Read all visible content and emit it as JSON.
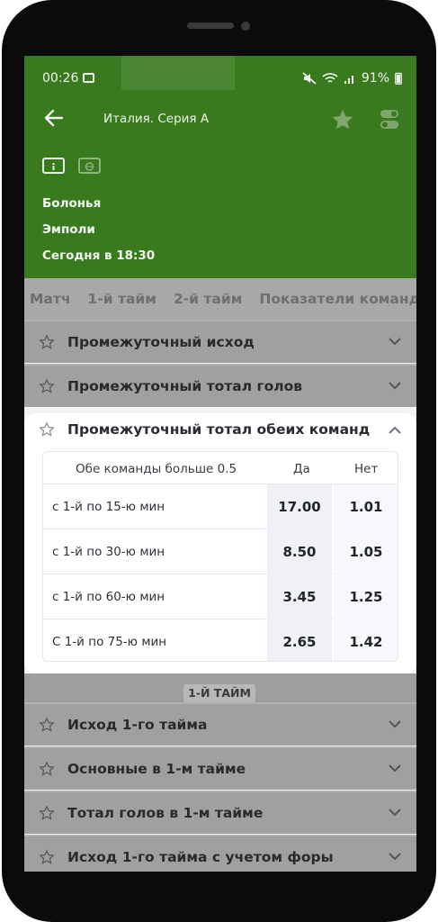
{
  "status_bar": {
    "time": "00:26",
    "battery": "91%"
  },
  "topbar": {
    "title": "Италия. Серия А"
  },
  "match": {
    "home_team": "Болонья",
    "away_team": "Эмполи",
    "start_time": "Сегодня в 18:30"
  },
  "tabs": [
    "Матч",
    "1-й тайм",
    "2-й тайм",
    "Показатели команд"
  ],
  "markets_top": [
    {
      "label": "Промежуточный исход"
    },
    {
      "label": "Промежуточный тотал голов"
    }
  ],
  "expanded_market": {
    "label": "Промежуточный тотал обеих команд",
    "table": {
      "header": {
        "name": "Обе команды больше 0.5",
        "yes": "Да",
        "no": "Нет"
      },
      "rows": [
        {
          "label": "с 1-й по 15-ю мин",
          "yes": "17.00",
          "no": "1.01"
        },
        {
          "label": "с 1-й по 30-ю мин",
          "yes": "8.50",
          "no": "1.05"
        },
        {
          "label": "с 1-й по 60-ю мин",
          "yes": "3.45",
          "no": "1.25"
        },
        {
          "label": "С 1-й по 75-ю мин",
          "yes": "2.65",
          "no": "1.42"
        }
      ]
    }
  },
  "section_badge": "1-Й ТАЙМ",
  "markets_bottom": [
    {
      "label": "Исход 1-го тайма"
    },
    {
      "label": "Основные в 1-м тайме"
    },
    {
      "label": "Тотал голов в 1-м тайме"
    },
    {
      "label": "Исход 1-го тайма с учетом форы"
    }
  ],
  "colors": {
    "header_green": "#3a7a1e",
    "overlay_gray": "#a0a0a0"
  }
}
